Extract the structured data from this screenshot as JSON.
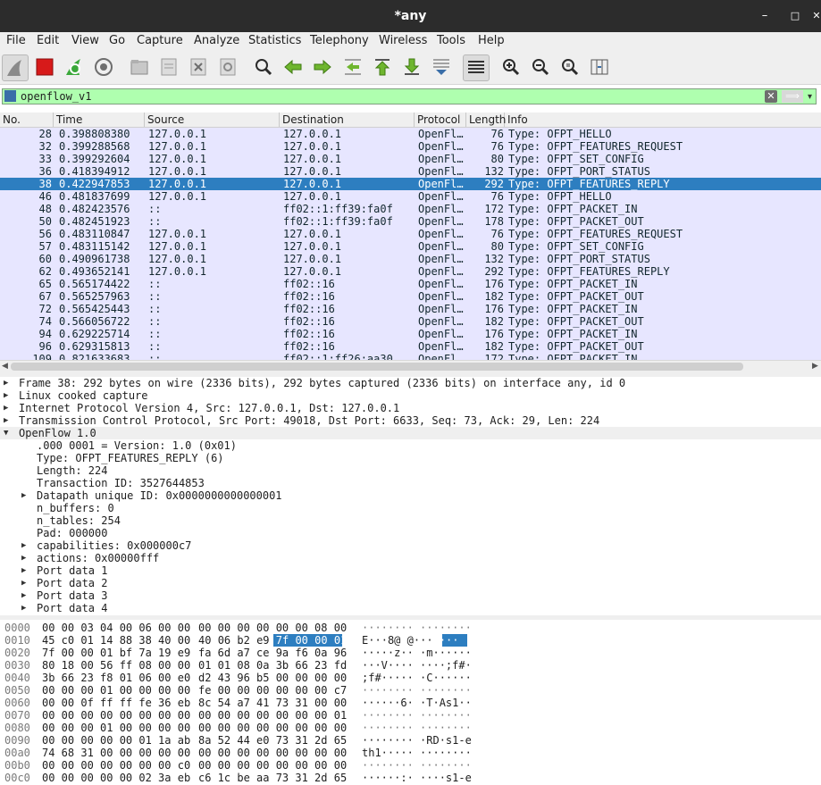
{
  "window": {
    "title": "*any",
    "minimize": "–",
    "maximize": "□",
    "close": "✕"
  },
  "menu": [
    "File",
    "Edit",
    "View",
    "Go",
    "Capture",
    "Analyze",
    "Statistics",
    "Telephony",
    "Wireless",
    "Tools",
    "Help"
  ],
  "toolbar": {
    "icons": [
      "shark-fin-start-icon",
      "stop-capture-icon",
      "restart-capture-icon",
      "capture-options-icon",
      "open-file-icon",
      "save-file-icon",
      "close-file-icon",
      "reload-file-icon",
      "find-packet-icon",
      "go-back-icon",
      "go-forward-icon",
      "go-to-packet-icon",
      "go-first-icon",
      "go-last-icon",
      "auto-scroll-icon",
      "colorize-icon",
      "zoom-in-icon",
      "zoom-out-icon",
      "normal-size-icon",
      "resize-columns-icon"
    ]
  },
  "filter": {
    "value": "openflow_v1",
    "clear_glyph": "✕",
    "apply_glyph": "⟹",
    "dropdown_glyph": "▾"
  },
  "packet_list": {
    "columns": [
      "No.",
      "Time",
      "Source",
      "Destination",
      "Protocol",
      "Length",
      "Info"
    ],
    "rows": [
      {
        "no": "28",
        "time": "0.398808380",
        "src": "127.0.0.1",
        "dst": "127.0.0.1",
        "proto": "OpenFl…",
        "len": "76",
        "info": "Type: OFPT_HELLO"
      },
      {
        "no": "32",
        "time": "0.399288568",
        "src": "127.0.0.1",
        "dst": "127.0.0.1",
        "proto": "OpenFl…",
        "len": "76",
        "info": "Type: OFPT_FEATURES_REQUEST"
      },
      {
        "no": "33",
        "time": "0.399292604",
        "src": "127.0.0.1",
        "dst": "127.0.0.1",
        "proto": "OpenFl…",
        "len": "80",
        "info": "Type: OFPT_SET_CONFIG"
      },
      {
        "no": "36",
        "time": "0.418394912",
        "src": "127.0.0.1",
        "dst": "127.0.0.1",
        "proto": "OpenFl…",
        "len": "132",
        "info": "Type: OFPT_PORT_STATUS"
      },
      {
        "no": "38",
        "time": "0.422947853",
        "src": "127.0.0.1",
        "dst": "127.0.0.1",
        "proto": "OpenFl…",
        "len": "292",
        "info": "Type: OFPT_FEATURES_REPLY",
        "selected": true
      },
      {
        "no": "46",
        "time": "0.481837699",
        "src": "127.0.0.1",
        "dst": "127.0.0.1",
        "proto": "OpenFl…",
        "len": "76",
        "info": "Type: OFPT_HELLO"
      },
      {
        "no": "48",
        "time": "0.482423576",
        "src": "::",
        "dst": "ff02::1:ff39:fa0f",
        "proto": "OpenFl…",
        "len": "172",
        "info": "Type: OFPT_PACKET_IN"
      },
      {
        "no": "50",
        "time": "0.482451923",
        "src": "::",
        "dst": "ff02::1:ff39:fa0f",
        "proto": "OpenFl…",
        "len": "178",
        "info": "Type: OFPT_PACKET_OUT"
      },
      {
        "no": "56",
        "time": "0.483110847",
        "src": "127.0.0.1",
        "dst": "127.0.0.1",
        "proto": "OpenFl…",
        "len": "76",
        "info": "Type: OFPT_FEATURES_REQUEST"
      },
      {
        "no": "57",
        "time": "0.483115142",
        "src": "127.0.0.1",
        "dst": "127.0.0.1",
        "proto": "OpenFl…",
        "len": "80",
        "info": "Type: OFPT_SET_CONFIG"
      },
      {
        "no": "60",
        "time": "0.490961738",
        "src": "127.0.0.1",
        "dst": "127.0.0.1",
        "proto": "OpenFl…",
        "len": "132",
        "info": "Type: OFPT_PORT_STATUS"
      },
      {
        "no": "62",
        "time": "0.493652141",
        "src": "127.0.0.1",
        "dst": "127.0.0.1",
        "proto": "OpenFl…",
        "len": "292",
        "info": "Type: OFPT_FEATURES_REPLY"
      },
      {
        "no": "65",
        "time": "0.565174422",
        "src": "::",
        "dst": "ff02::16",
        "proto": "OpenFl…",
        "len": "176",
        "info": "Type: OFPT_PACKET_IN"
      },
      {
        "no": "67",
        "time": "0.565257963",
        "src": "::",
        "dst": "ff02::16",
        "proto": "OpenFl…",
        "len": "182",
        "info": "Type: OFPT_PACKET_OUT"
      },
      {
        "no": "72",
        "time": "0.565425443",
        "src": "::",
        "dst": "ff02::16",
        "proto": "OpenFl…",
        "len": "176",
        "info": "Type: OFPT_PACKET_IN"
      },
      {
        "no": "74",
        "time": "0.566056722",
        "src": "::",
        "dst": "ff02::16",
        "proto": "OpenFl…",
        "len": "182",
        "info": "Type: OFPT_PACKET_OUT"
      },
      {
        "no": "94",
        "time": "0.629225714",
        "src": "::",
        "dst": "ff02::16",
        "proto": "OpenFl…",
        "len": "176",
        "info": "Type: OFPT_PACKET_IN"
      },
      {
        "no": "96",
        "time": "0.629315813",
        "src": "::",
        "dst": "ff02::16",
        "proto": "OpenFl…",
        "len": "182",
        "info": "Type: OFPT_PACKET_OUT"
      },
      {
        "no": "109",
        "time": "0.821633683",
        "src": "::",
        "dst": "ff02::1:ff26:aa30",
        "proto": "OpenFl…",
        "len": "172",
        "info": "Type: OFPT_PACKET_IN"
      }
    ]
  },
  "details": [
    {
      "text": "Frame 38: 292 bytes on wire (2336 bits), 292 bytes captured (2336 bits) on interface any, id 0",
      "level": 0,
      "toggle": "collapsed"
    },
    {
      "text": "Linux cooked capture",
      "level": 0,
      "toggle": "collapsed"
    },
    {
      "text": "Internet Protocol Version 4, Src: 127.0.0.1, Dst: 127.0.0.1",
      "level": 0,
      "toggle": "collapsed"
    },
    {
      "text": "Transmission Control Protocol, Src Port: 49018, Dst Port: 6633, Seq: 73, Ack: 29, Len: 224",
      "level": 0,
      "toggle": "collapsed"
    },
    {
      "text": "OpenFlow 1.0",
      "level": 0,
      "toggle": "expanded",
      "highlight": true
    },
    {
      "text": ".000 0001 = Version: 1.0 (0x01)",
      "level": 1,
      "toggle": "none"
    },
    {
      "text": "Type: OFPT_FEATURES_REPLY (6)",
      "level": 1,
      "toggle": "none"
    },
    {
      "text": "Length: 224",
      "level": 1,
      "toggle": "none"
    },
    {
      "text": "Transaction ID: 3527644853",
      "level": 1,
      "toggle": "none"
    },
    {
      "text": "Datapath unique ID: 0x0000000000000001",
      "level": 1,
      "toggle": "collapsed"
    },
    {
      "text": "n_buffers: 0",
      "level": 1,
      "toggle": "none"
    },
    {
      "text": "n_tables: 254",
      "level": 1,
      "toggle": "none"
    },
    {
      "text": "Pad: 000000",
      "level": 1,
      "toggle": "none"
    },
    {
      "text": "capabilities: 0x000000c7",
      "level": 1,
      "toggle": "collapsed"
    },
    {
      "text": "actions: 0x00000fff",
      "level": 1,
      "toggle": "collapsed"
    },
    {
      "text": "Port data 1",
      "level": 1,
      "toggle": "collapsed"
    },
    {
      "text": "Port data 2",
      "level": 1,
      "toggle": "collapsed"
    },
    {
      "text": "Port data 3",
      "level": 1,
      "toggle": "collapsed"
    },
    {
      "text": "Port data 4",
      "level": 1,
      "toggle": "collapsed"
    }
  ],
  "bytes": [
    {
      "off": "0000",
      "hex1": "00 00 03 04 00 06 00 00",
      "hex2": "00 00 00 00 00 00 08 00",
      "ascii": "········ ········"
    },
    {
      "off": "0010",
      "hex1": "45 c0 01 14 88 38 40 00",
      "hex2": "40 06 b2 e9 7f 00 00 01",
      "ascii": "E···8@ @·······",
      "highlight": true
    },
    {
      "off": "0020",
      "hex1": "7f 00 00 01 bf 7a 19 e9",
      "hex2": "fa 6d a7 ce 9a f6 0a 96",
      "ascii": "·····z·· ·m······"
    },
    {
      "off": "0030",
      "hex1": "80 18 00 56 ff 08 00 00",
      "hex2": "01 01 08 0a 3b 66 23 fd",
      "ascii": "···V···· ····;f#·"
    },
    {
      "off": "0040",
      "hex1": "3b 66 23 f8 01 06 00 e0",
      "hex2": "d2 43 96 b5 00 00 00 00",
      "ascii": ";f#····· ·C······"
    },
    {
      "off": "0050",
      "hex1": "00 00 00 01 00 00 00 00",
      "hex2": "fe 00 00 00 00 00 00 c7",
      "ascii": "········ ········"
    },
    {
      "off": "0060",
      "hex1": "00 00 0f ff ff fe 36 eb",
      "hex2": "8c 54 a7 41 73 31 00 00",
      "ascii": "······6· ·T·As1··"
    },
    {
      "off": "0070",
      "hex1": "00 00 00 00 00 00 00 00",
      "hex2": "00 00 00 00 00 00 00 01",
      "ascii": "········ ········"
    },
    {
      "off": "0080",
      "hex1": "00 00 00 01 00 00 00 00",
      "hex2": "00 00 00 00 00 00 00 00",
      "ascii": "········ ········"
    },
    {
      "off": "0090",
      "hex1": "00 00 00 00 00 01 1a ab",
      "hex2": "8a 52 44 e0 73 31 2d 65",
      "ascii": "········ ·RD·s1-e"
    },
    {
      "off": "00a0",
      "hex1": "74 68 31 00 00 00 00 00",
      "hex2": "00 00 00 00 00 00 00 00",
      "ascii": "th1····· ········"
    },
    {
      "off": "00b0",
      "hex1": "00 00 00 00 00 00 00 c0",
      "hex2": "00 00 00 00 00 00 00 00",
      "ascii": "········ ········"
    },
    {
      "off": "00c0",
      "hex1": "00 00 00 00 00 02 3a eb",
      "hex2": "c6 1c be aa 73 31 2d 65",
      "ascii": "······:· ····s1-e"
    }
  ],
  "colors": {
    "row_bg": "#e7e6ff",
    "selected_bg": "#2d7ec0",
    "filter_valid": "#afffaf",
    "titlebar": "#2c2c2c"
  }
}
